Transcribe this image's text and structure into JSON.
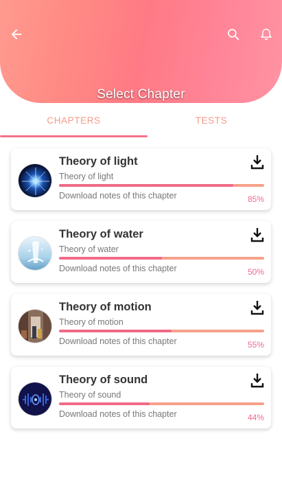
{
  "header": {
    "title": "Select Chapter",
    "icons": {
      "back": "back-arrow-icon",
      "search": "search-icon",
      "notifications": "bell-icon"
    },
    "gradient_colors": [
      "#ff9a8f",
      "#ff7a85",
      "#ff93a2"
    ]
  },
  "tabs": [
    {
      "label": "CHAPTERS",
      "active": true
    },
    {
      "label": "TESTS",
      "active": false
    }
  ],
  "colors": {
    "accent": "#f06a87",
    "track": "#f7a08a",
    "tab_text": "#f7988a"
  },
  "chapters": [
    {
      "title": "Theory of light",
      "subtitle": "Theory of light",
      "notes": "Download notes of this chapter",
      "percent": "85%",
      "progress": 0.85,
      "image": "light-burst-image"
    },
    {
      "title": "Theory of water",
      "subtitle": "Theory of water",
      "notes": "Download notes of this chapter",
      "percent": "50%",
      "progress": 0.5,
      "image": "water-splash-image"
    },
    {
      "title": "Theory of motion",
      "subtitle": "Theory of motion",
      "notes": "Download notes of this chapter",
      "percent": "55%",
      "progress": 0.55,
      "image": "street-motion-image"
    },
    {
      "title": "Theory of sound",
      "subtitle": "Theory of sound",
      "notes": "Download notes of this chapter",
      "percent": "44%",
      "progress": 0.44,
      "image": "sound-wave-image"
    }
  ]
}
